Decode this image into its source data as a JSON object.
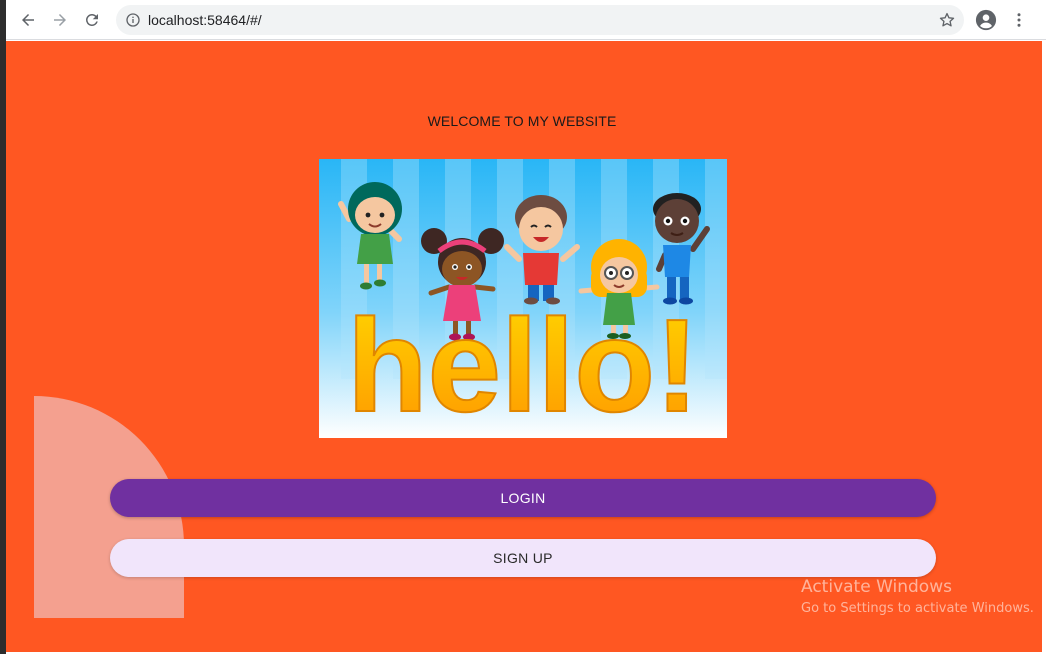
{
  "browser": {
    "url": "localhost:58464/#/"
  },
  "page": {
    "welcome_text": "WELCOME TO MY WEBSITE",
    "hero_text": "hello!",
    "login_label": "LOGIN",
    "signup_label": "SIGN UP"
  },
  "watermark": {
    "title": "Activate Windows",
    "subtitle": "Go to Settings to activate Windows."
  },
  "colors": {
    "page_background": "#ff5722",
    "login_button": "#7030a0",
    "signup_button": "#f1e5fb",
    "hero_text": "#ffc107"
  },
  "icons": {
    "back": "arrow-left-icon",
    "forward": "arrow-right-icon",
    "reload": "reload-icon",
    "info": "info-icon",
    "bookmark": "star-icon",
    "profile": "account-circle-icon",
    "menu": "kebab-menu-icon"
  }
}
